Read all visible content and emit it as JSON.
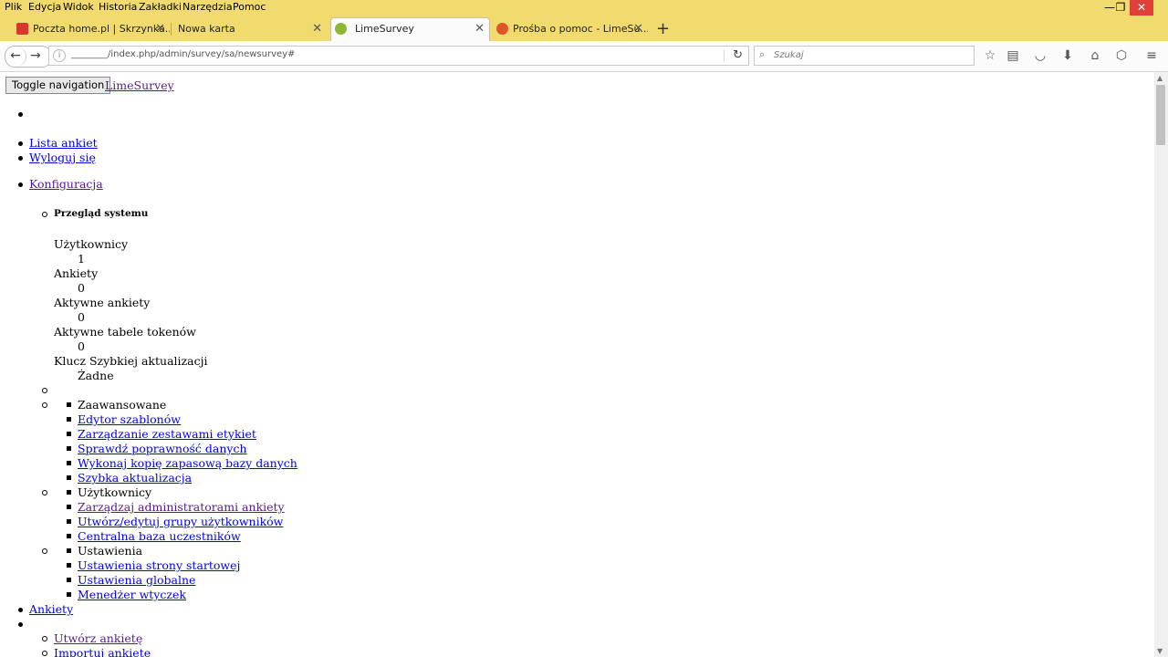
{
  "menubar": [
    "Plik",
    "Edycja",
    "Widok",
    "Historia",
    "Zakładki",
    "Narzędzia",
    "Pomoc"
  ],
  "window_controls": {
    "minimize": "—",
    "maximize": "❐",
    "close": "✕"
  },
  "tabs": [
    {
      "label": "Poczta home.pl | Skrzynka...",
      "close": "✕",
      "favicon_color": "#d8382c"
    },
    {
      "label": "Nowa karta",
      "close": "✕"
    },
    {
      "label": "LimeSurvey",
      "close": "✕",
      "favicon_color": "#8ab834",
      "active": true
    },
    {
      "label": "Prośba o pomoc - LimeSu...",
      "close": "✕",
      "favicon_color": "#e0552a"
    }
  ],
  "newtab_label": "+",
  "nav": {
    "back": "←",
    "forward": "→",
    "url": "________/index.php/admin/survey/sa/newsurvey#",
    "reload": "↻",
    "search_placeholder": "Szukaj",
    "toolbar_icons": [
      "star-icon",
      "reading-list-icon",
      "pocket-icon",
      "download-icon",
      "home-icon",
      "addon-icon",
      "hamburger-menu-icon"
    ]
  },
  "page": {
    "toggle_navigation": "Toggle navigation",
    "brand": "LimeSurvey",
    "links_top": [
      "Lista ankiet",
      "Wyloguj się"
    ],
    "konfiguracja": "Konfiguracja",
    "przeglad": "Przegląd systemu",
    "stats": [
      {
        "label": "Użytkownicy",
        "value": "1"
      },
      {
        "label": "Ankiety",
        "value": "0"
      },
      {
        "label": "Aktywne ankiety",
        "value": "0"
      },
      {
        "label": "Aktywne tabele tokenów",
        "value": "0"
      },
      {
        "label": "Klucz Szybkiej aktualizacji",
        "value": "Żadne"
      }
    ],
    "sections": [
      {
        "title": "Zaawansowane",
        "items": [
          "Edytor szablonów",
          "Zarządzanie zestawami etykiet",
          "Sprawdź poprawność danych",
          "Wykonaj kopię zapasową bazy danych",
          "Szybka aktualizacja"
        ]
      },
      {
        "title": "Użytkownicy",
        "items": [
          "Zarządzaj administratorami ankiety",
          "Utwórz/edytuj grupy użytkowników",
          "Centralna baza uczestników"
        ]
      },
      {
        "title": "Ustawienia",
        "items": [
          "Ustawienia strony startowej",
          "Ustawienia globalne",
          "Menedżer wtyczek"
        ]
      }
    ],
    "ankiety": "Ankiety",
    "ankiety_items": [
      "Utwórz ankietę",
      "Importuj ankietę"
    ]
  }
}
